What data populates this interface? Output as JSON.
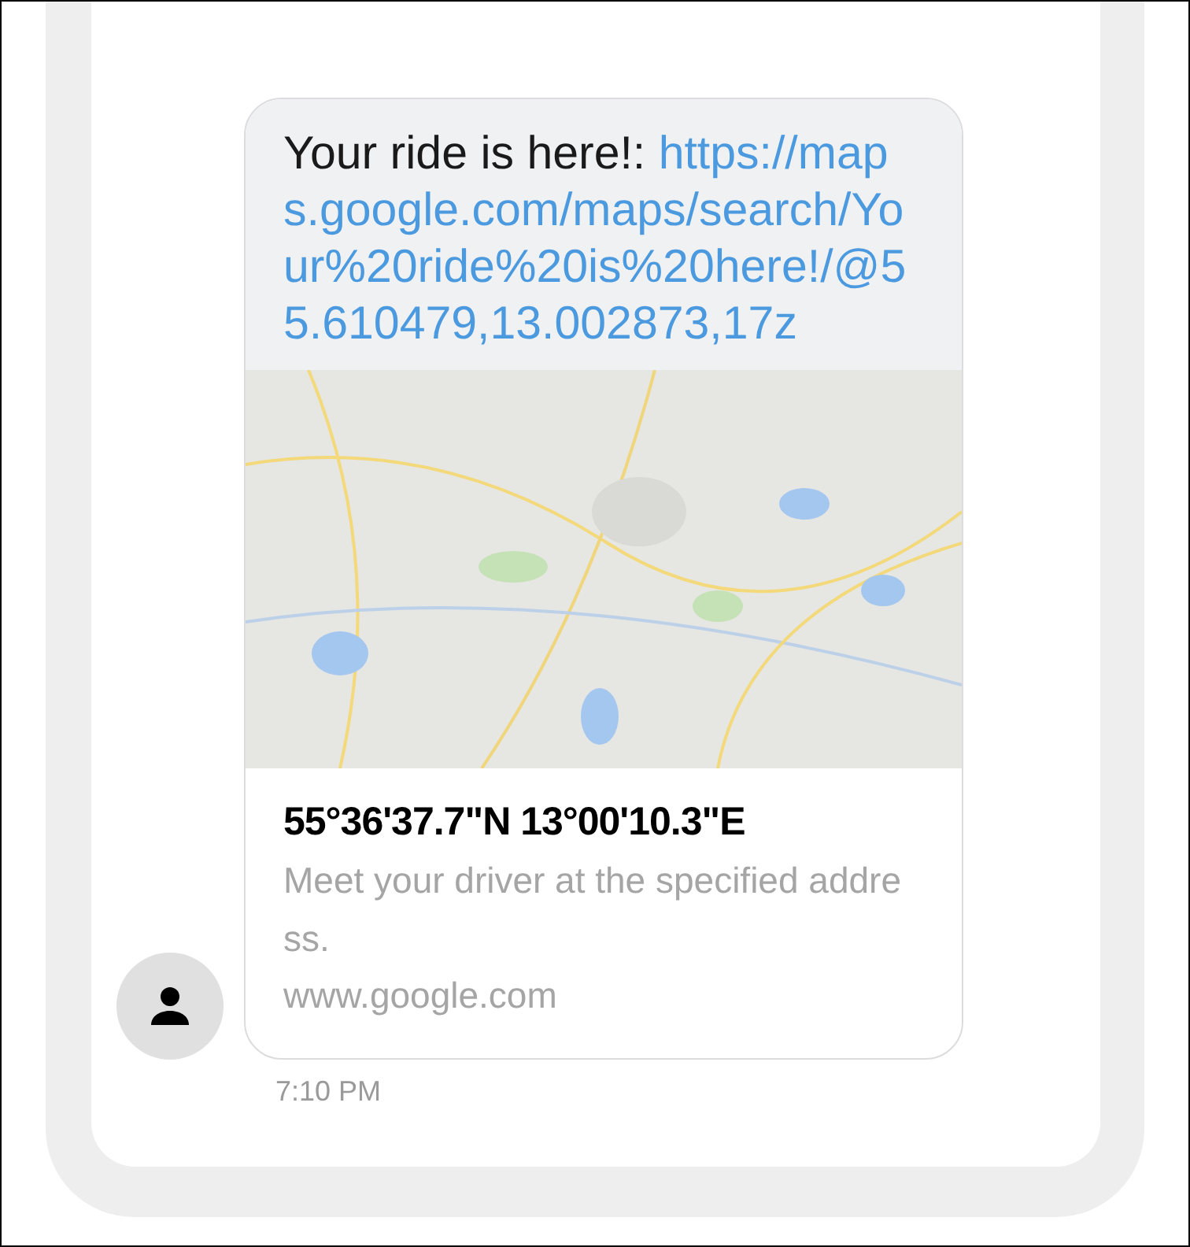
{
  "message": {
    "text": "Your ride is here!: ",
    "link": "https://maps.google.com/maps/search/Your%20ride%20is%20here!/@55.610479,13.002873,17z",
    "preview": {
      "title": "55°36'37.7\"N 13°00'10.3\"E",
      "description": "Meet your driver at the specified address.",
      "domain": "www.google.com"
    },
    "time": "7:10 PM"
  }
}
